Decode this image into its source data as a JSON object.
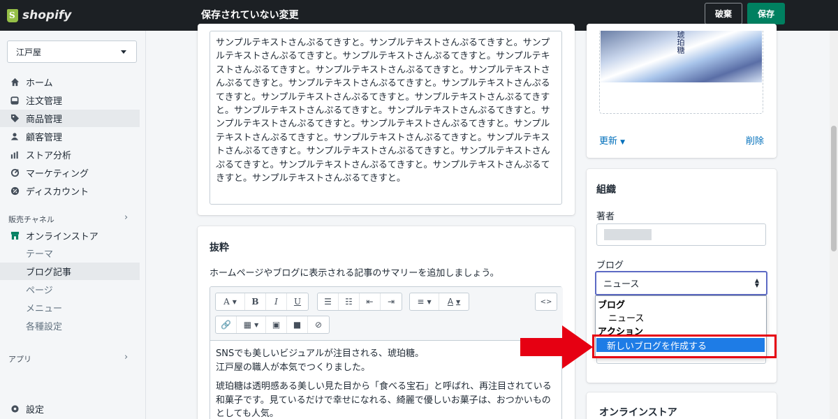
{
  "topbar": {
    "brand": "shopify",
    "title": "保存されていない変更",
    "discard_label": "破棄",
    "save_label": "保存"
  },
  "sidebar": {
    "store_name": "江戸屋",
    "nav": [
      {
        "label": "ホーム",
        "icon": "home-icon"
      },
      {
        "label": "注文管理",
        "icon": "orders-icon"
      },
      {
        "label": "商品管理",
        "icon": "tag-icon"
      },
      {
        "label": "顧客管理",
        "icon": "customer-icon"
      },
      {
        "label": "ストア分析",
        "icon": "analytics-icon"
      },
      {
        "label": "マーケティング",
        "icon": "marketing-icon"
      },
      {
        "label": "ディスカウント",
        "icon": "discount-icon"
      }
    ],
    "sales_channels_label": "販売チャネル",
    "online_store_label": "オンラインストア",
    "sub_items": [
      "テーマ",
      "ブログ記事",
      "ページ",
      "メニュー",
      "各種設定"
    ],
    "apps_label": "アプリ",
    "settings_label": "設定"
  },
  "content": {
    "body_text": "サンプルテキストさんぷるてきすと。サンプルテキストさんぷるてきすと。サンプルテキストさんぷるてきすと。サンプルテキストさんぷるてきすと。サンプルテキストさんぷるてきすと。サンプルテキストさんぷるてきすと。サンプルテキストさんぷるてきすと。サンプルテキストさんぷるてきすと。サンプルテキストさんぷるてきすと。サンプルテキストさんぷるてきすと。サンプルテキストさんぷるてきすと。サンプルテキストさんぷるてきすと。サンプルテキストさんぷるてきすと。サンプルテキストさんぷるてきすと。サンプルテキストさんぷるてきすと。サンプルテキストさんぷるてきすと。サンプルテキストさんぷるてきすと。サンプルテキストさんぷるてきすと。サンプルテキストさんぷるてきすと。サンプルテキストさんぷるてきすと。サンプルテキストさんぷるてきすと。サンプルテキストさんぷるてきすと。サンプルテキストさんぷるてきすと。",
    "excerpt_title": "抜粋",
    "excerpt_help": "ホームページやブログに表示される記事のサマリーを追加しましょう。",
    "excerpt_line1": "SNSでも美しいビジュアルが注目される、琥珀糖。",
    "excerpt_line2": "江戸屋の職人が本気でつくりました。",
    "excerpt_para2": "琥珀糖は透明感ある美しい見た目から「食べる宝石」と呼ばれ、再注目されている和菓子です。見ているだけで幸せになれる、綺麗で優しいお菓子は、おつかいものとしても人気。"
  },
  "image_card": {
    "thumb_text": "琥珀糖",
    "update_label": "更新",
    "delete_label": "削除"
  },
  "organization": {
    "title": "組織",
    "author_label": "著者",
    "blog_label": "ブログ",
    "blog_value": "ニュース",
    "dropdown": {
      "group1": "ブログ",
      "opt1": "ニュース",
      "group2": "アクション",
      "opt2": "新しいブログを作成する"
    }
  },
  "online_store_card": {
    "title": "オンラインストア"
  },
  "colors": {
    "topbar": "#1c2024",
    "save": "#008060",
    "link": "#006fbb",
    "highlight": "#e60012",
    "selected_option": "#1e7ce6"
  }
}
